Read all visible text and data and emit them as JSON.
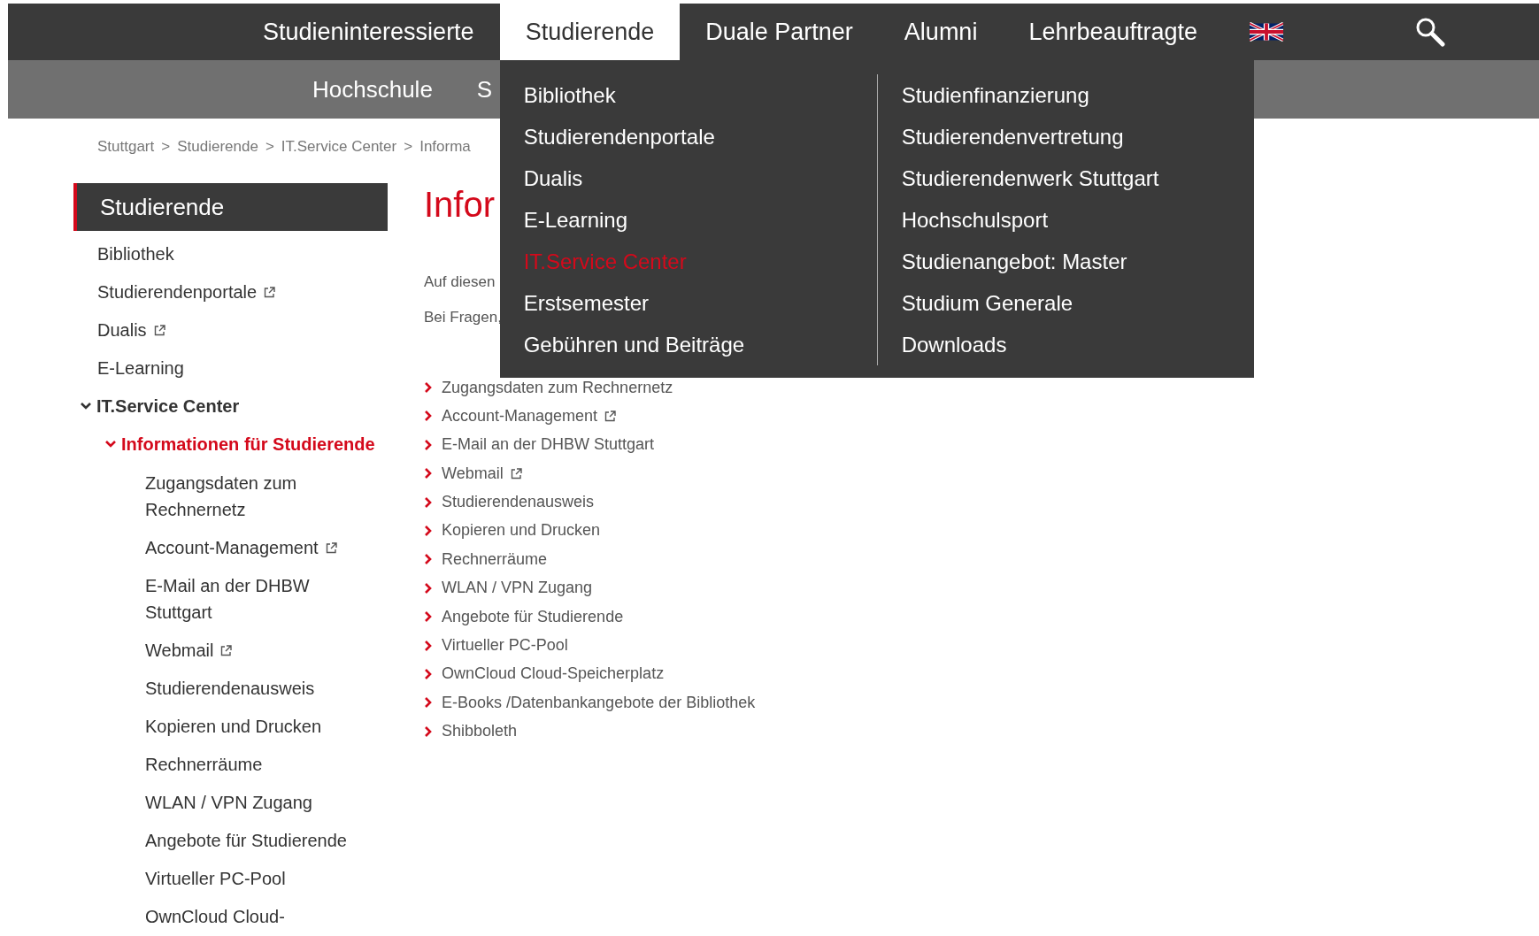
{
  "top_nav": [
    {
      "label": "Studieninteressierte",
      "selected": false
    },
    {
      "label": "Studierende",
      "selected": true
    },
    {
      "label": "Duale Partner",
      "selected": false
    },
    {
      "label": "Alumni",
      "selected": false
    },
    {
      "label": "Lehrbeauftragte",
      "selected": false
    }
  ],
  "sub_nav": [
    {
      "label": "Hochschule"
    },
    {
      "label": "S"
    }
  ],
  "dropdown": {
    "columns": [
      [
        {
          "label": "Bibliothek",
          "selected": false
        },
        {
          "label": "Studierendenportale",
          "selected": false
        },
        {
          "label": "Dualis",
          "selected": false
        },
        {
          "label": "E-Learning",
          "selected": false
        },
        {
          "label": "IT.Service Center",
          "selected": true
        },
        {
          "label": "Erstsemester",
          "selected": false
        },
        {
          "label": "Gebühren und Beiträge",
          "selected": false
        }
      ],
      [
        {
          "label": "Studienfinanzierung",
          "selected": false
        },
        {
          "label": "Studierendenvertretung",
          "selected": false
        },
        {
          "label": "Studierendenwerk Stuttgart",
          "selected": false
        },
        {
          "label": "Hochschulsport",
          "selected": false
        },
        {
          "label": "Studienangebot: Master",
          "selected": false
        },
        {
          "label": "Studium Generale",
          "selected": false
        },
        {
          "label": "Downloads",
          "selected": false
        }
      ]
    ]
  },
  "breadcrumb": {
    "separator": ">",
    "items": [
      "Stuttgart",
      "Studierende",
      "IT.Service Center",
      "Informa"
    ]
  },
  "sidebar": {
    "title": "Studierende",
    "items": [
      {
        "label": "Bibliothek",
        "external": false,
        "selected": false
      },
      {
        "label": "Studierendenportale",
        "external": true,
        "selected": false
      },
      {
        "label": "Dualis",
        "external": true,
        "selected": false
      },
      {
        "label": "E-Learning",
        "external": false,
        "selected": false
      },
      {
        "label": "IT.Service Center",
        "external": false,
        "selected": false,
        "expanded": true,
        "children": [
          {
            "label": "Informationen für Studierende",
            "external": false,
            "selected": true,
            "expanded": true,
            "children": [
              {
                "label": "Zugangsdaten zum Rechnernetz",
                "external": false,
                "selected": false
              },
              {
                "label": "Account-Management",
                "external": true,
                "selected": false
              },
              {
                "label": "E-Mail an der DHBW Stuttgart",
                "external": false,
                "selected": false
              },
              {
                "label": "Webmail",
                "external": true,
                "selected": false
              },
              {
                "label": "Studierendenausweis",
                "external": false,
                "selected": false
              },
              {
                "label": "Kopieren und Drucken",
                "external": false,
                "selected": false
              },
              {
                "label": "Rechnerräume",
                "external": false,
                "selected": false
              },
              {
                "label": "WLAN / VPN Zugang",
                "external": false,
                "selected": false
              },
              {
                "label": "Angebote für Studierende",
                "external": false,
                "selected": false
              },
              {
                "label": "Virtueller PC-Pool",
                "external": false,
                "selected": false
              },
              {
                "label": "OwnCloud Cloud-",
                "external": false,
                "selected": false
              }
            ]
          }
        ]
      }
    ]
  },
  "main": {
    "heading": "Infor",
    "paragraphs": [
      "Auf diesen",
      "Bei Fragen,"
    ],
    "links": [
      {
        "label": "Zugangsdaten zum Rechnernetz",
        "external": false
      },
      {
        "label": "Account-Management",
        "external": true
      },
      {
        "label": "E-Mail an der DHBW Stuttgart",
        "external": false
      },
      {
        "label": "Webmail",
        "external": true
      },
      {
        "label": "Studierendenausweis",
        "external": false
      },
      {
        "label": "Kopieren und Drucken",
        "external": false
      },
      {
        "label": "Rechnerräume",
        "external": false
      },
      {
        "label": "WLAN / VPN Zugang",
        "external": false
      },
      {
        "label": "Angebote für Studierende",
        "external": false
      },
      {
        "label": "Virtueller PC-Pool",
        "external": false
      },
      {
        "label": "OwnCloud Cloud-Speicherplatz",
        "external": false
      },
      {
        "label": "E-Books /Datenbankangebote der Bibliothek",
        "external": false
      },
      {
        "label": "Shibboleth",
        "external": false
      }
    ]
  }
}
